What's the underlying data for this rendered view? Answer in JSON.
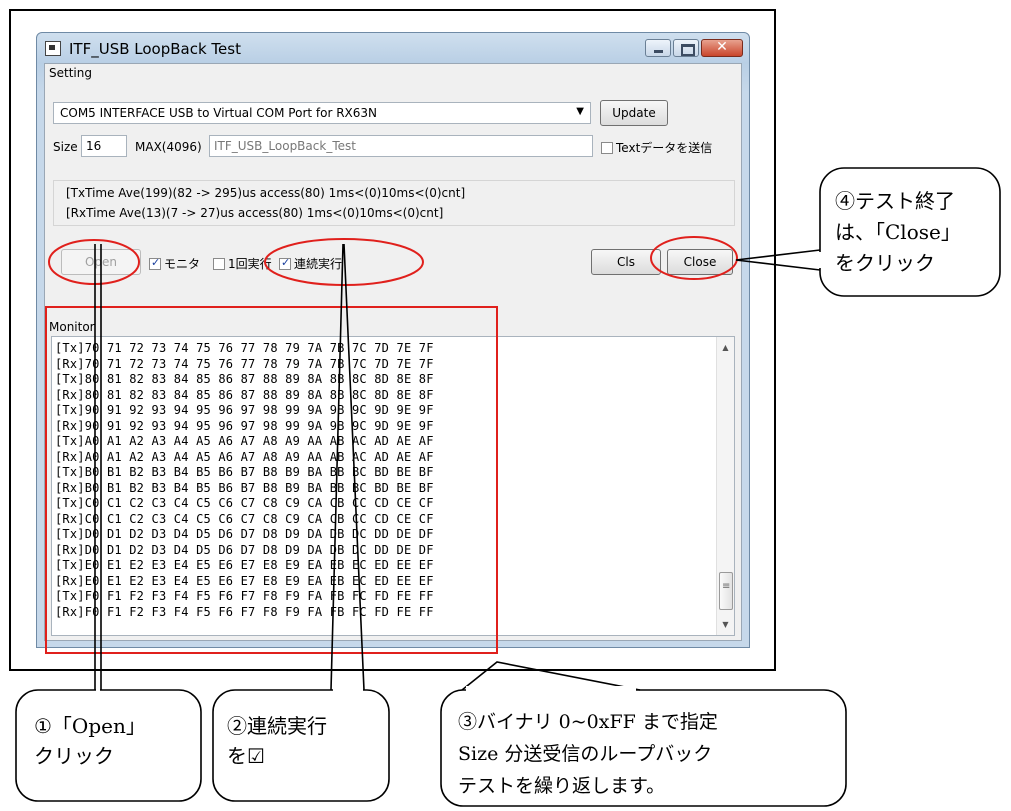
{
  "window": {
    "title": "ITF_USB LoopBack Test",
    "colors": {
      "title_bg": "#b9cfe5",
      "close_btn": "#c9452b"
    }
  },
  "setting": {
    "group_label": "Setting",
    "port_value": "COM5  INTERFACE USB to Virtual COM Port for RX63N",
    "update_label": "Update",
    "size_label": "Size",
    "size_value": "16",
    "max_label": "MAX(4096)",
    "text_value": "ITF_USB_LoopBack_Test",
    "send_text_label": "Textデータを送信",
    "send_text_checked": false
  },
  "timing": {
    "tx_line": "[TxTime Ave(199)(82 -> 295)us access(80) 1ms<(0)10ms<(0)cnt]",
    "rx_line": "[RxTime Ave(13)(7 -> 27)us access(80) 1ms<(0)10ms<(0)cnt]"
  },
  "controls": {
    "open_label": "Open",
    "open_enabled": false,
    "monitor_check_label": "モニタ",
    "monitor_checked": true,
    "once_label": "1回実行",
    "once_checked": false,
    "continuous_label": "連続実行",
    "continuous_checked": true,
    "cls_label": "Cls",
    "close_label": "Close"
  },
  "monitor": {
    "group_label": "Monitor",
    "rows": [
      "[Tx]70 71 72 73 74 75 76 77 78 79 7A 7B 7C 7D 7E 7F",
      "[Rx]70 71 72 73 74 75 76 77 78 79 7A 7B 7C 7D 7E 7F",
      "[Tx]80 81 82 83 84 85 86 87 88 89 8A 8B 8C 8D 8E 8F",
      "[Rx]80 81 82 83 84 85 86 87 88 89 8A 8B 8C 8D 8E 8F",
      "[Tx]90 91 92 93 94 95 96 97 98 99 9A 9B 9C 9D 9E 9F",
      "[Rx]90 91 92 93 94 95 96 97 98 99 9A 9B 9C 9D 9E 9F",
      "[Tx]A0 A1 A2 A3 A4 A5 A6 A7 A8 A9 AA AB AC AD AE AF",
      "[Rx]A0 A1 A2 A3 A4 A5 A6 A7 A8 A9 AA AB AC AD AE AF",
      "[Tx]B0 B1 B2 B3 B4 B5 B6 B7 B8 B9 BA BB BC BD BE BF",
      "[Rx]B0 B1 B2 B3 B4 B5 B6 B7 B8 B9 BA BB BC BD BE BF",
      "[Tx]C0 C1 C2 C3 C4 C5 C6 C7 C8 C9 CA CB CC CD CE CF",
      "[Rx]C0 C1 C2 C3 C4 C5 C6 C7 C8 C9 CA CB CC CD CE CF",
      "[Tx]D0 D1 D2 D3 D4 D5 D6 D7 D8 D9 DA DB DC DD DE DF",
      "[Rx]D0 D1 D2 D3 D4 D5 D6 D7 D8 D9 DA DB DC DD DE DF",
      "[Tx]E0 E1 E2 E3 E4 E5 E6 E7 E8 E9 EA EB EC ED EE EF",
      "[Rx]E0 E1 E2 E3 E4 E5 E6 E7 E8 E9 EA EB EC ED EE EF",
      "[Tx]F0 F1 F2 F3 F4 F5 F6 F7 F8 F9 FA FB FC FD FE FF",
      "[Rx]F0 F1 F2 F3 F4 F5 F6 F7 F8 F9 FA FB FC FD FE FF"
    ]
  },
  "annotations": {
    "accent_color": "#e0201c",
    "callout1": [
      "①「Open」",
      "クリック"
    ],
    "callout2": [
      "②連続実行",
      "を☑"
    ],
    "callout3": [
      "③バイナリ 0~0xFF まで指定",
      "Size 分送受信のループバック",
      "テストを繰り返します。"
    ],
    "callout4": [
      "④テスト終了",
      "は、「Close」",
      "をクリック"
    ]
  }
}
